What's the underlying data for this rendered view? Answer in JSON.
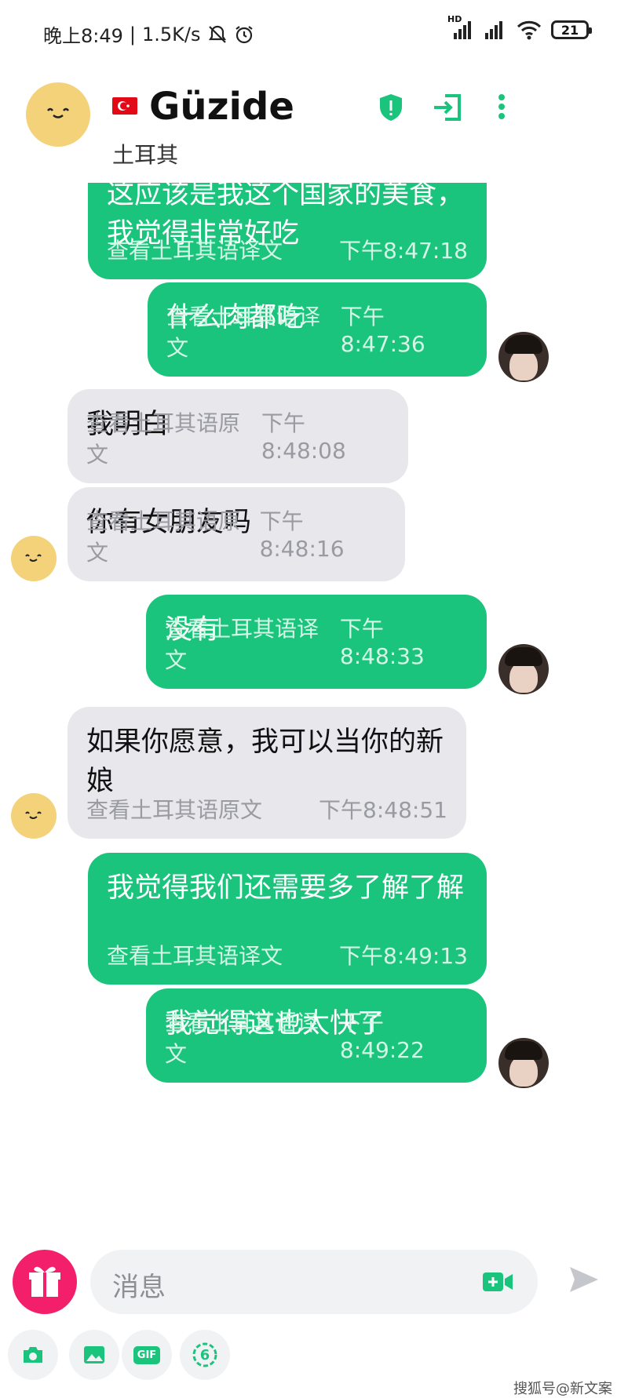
{
  "status_bar": {
    "time": "晚上8:49",
    "speed": "1.5K/s",
    "hd_label": "HD",
    "battery": "21"
  },
  "header": {
    "name": "Güzide",
    "country": "土耳其",
    "flag_color": "#e30a17",
    "accent": "#1bc47d"
  },
  "messages": [
    {
      "from": "me",
      "text": "这应该是我这个国家的美食，我觉得非常好吃",
      "action": "查看土耳其语译文",
      "time": "下午8:47:18"
    },
    {
      "from": "me",
      "text": "什么肉都吃",
      "action": "查看土耳其语译文",
      "time": "下午8:47:36"
    },
    {
      "from": "them",
      "text": "我明白",
      "action": "查看土耳其语原文",
      "time": "下午8:48:08"
    },
    {
      "from": "them",
      "text": "你有女朋友吗",
      "action": "查看土耳其语原文",
      "time": "下午8:48:16"
    },
    {
      "from": "me",
      "text": "没有",
      "action": "查看土耳其语译文",
      "time": "下午8:48:33"
    },
    {
      "from": "them",
      "text": "如果你愿意，我可以当你的新娘",
      "action": "查看土耳其语原文",
      "time": "下午8:48:51"
    },
    {
      "from": "me",
      "text": "我觉得我们还需要多了解了解",
      "action": "查看土耳其语译文",
      "time": "下午8:49:13"
    },
    {
      "from": "me",
      "text": "我觉得这也太快了",
      "action": "查看土耳其语译文",
      "time": "下午8:49:22"
    }
  ],
  "input": {
    "placeholder": "消息",
    "gif_label": "GIF",
    "six_label": "6"
  },
  "watermark": "搜狐号@新文案",
  "icons": [
    "alarm-off-icon",
    "alarm-icon",
    "signal-icon",
    "wifi-icon",
    "battery-icon",
    "shield-icon",
    "exit-icon",
    "more-icon",
    "gift-icon",
    "video-icon",
    "send-icon",
    "camera-icon",
    "image-icon",
    "gif-icon",
    "six-icon"
  ]
}
